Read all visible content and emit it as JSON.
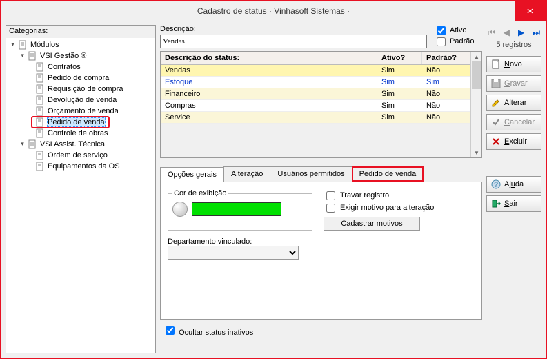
{
  "window_title": "Cadastro de status · Vinhasoft Sistemas ·",
  "categories_label": "Categorias:",
  "tree": {
    "root": "Módulos",
    "group1": "VSI Gestão ®",
    "items1": [
      "Contratos",
      "Pedido de compra",
      "Requisição de compra",
      "Devolução de venda",
      "Orçamento de venda",
      "Pedido de venda",
      "Controle de obras"
    ],
    "group2": "VSI Assist. Técnica",
    "items2": [
      "Ordem de serviço",
      "Equipamentos da OS"
    ]
  },
  "descricao_label": "Descrição:",
  "descricao_value": "Vendas",
  "ativo_label": "Ativo",
  "padrao_label": "Padrão",
  "grid": {
    "headers": {
      "desc": "Descrição do status:",
      "ativo": "Ativo?",
      "padrao": "Padrão?"
    },
    "rows": [
      {
        "desc": "Vendas",
        "ativo": "Sim",
        "padrao": "Não",
        "sel": true,
        "link": false
      },
      {
        "desc": "Estoque",
        "ativo": "Sim",
        "padrao": "Sim",
        "sel": false,
        "link": true
      },
      {
        "desc": "Financeiro",
        "ativo": "Sim",
        "padrao": "Não",
        "sel": false,
        "link": false
      },
      {
        "desc": "Compras",
        "ativo": "Sim",
        "padrao": "Não",
        "sel": false,
        "link": false
      },
      {
        "desc": "Service",
        "ativo": "Sim",
        "padrao": "Não",
        "sel": false,
        "link": false
      }
    ]
  },
  "tabs": [
    "Opções gerais",
    "Alteração",
    "Usuários permitidos",
    "Pedido de venda"
  ],
  "opcoes": {
    "cor_label": "Cor de exibição",
    "travar": "Travar registro",
    "exigir": "Exigir motivo para alteração",
    "cadastrar": "Cadastrar motivos",
    "departamento": "Departamento vinculado:"
  },
  "ocultar": "Ocultar status inativos",
  "registros": "5 registros",
  "buttons": {
    "novo": "Novo",
    "gravar": "Gravar",
    "alterar": "Alterar",
    "cancelar": "Cancelar",
    "excluir": "Excluir",
    "ajuda": "Ajuda",
    "sair": "Sair"
  }
}
